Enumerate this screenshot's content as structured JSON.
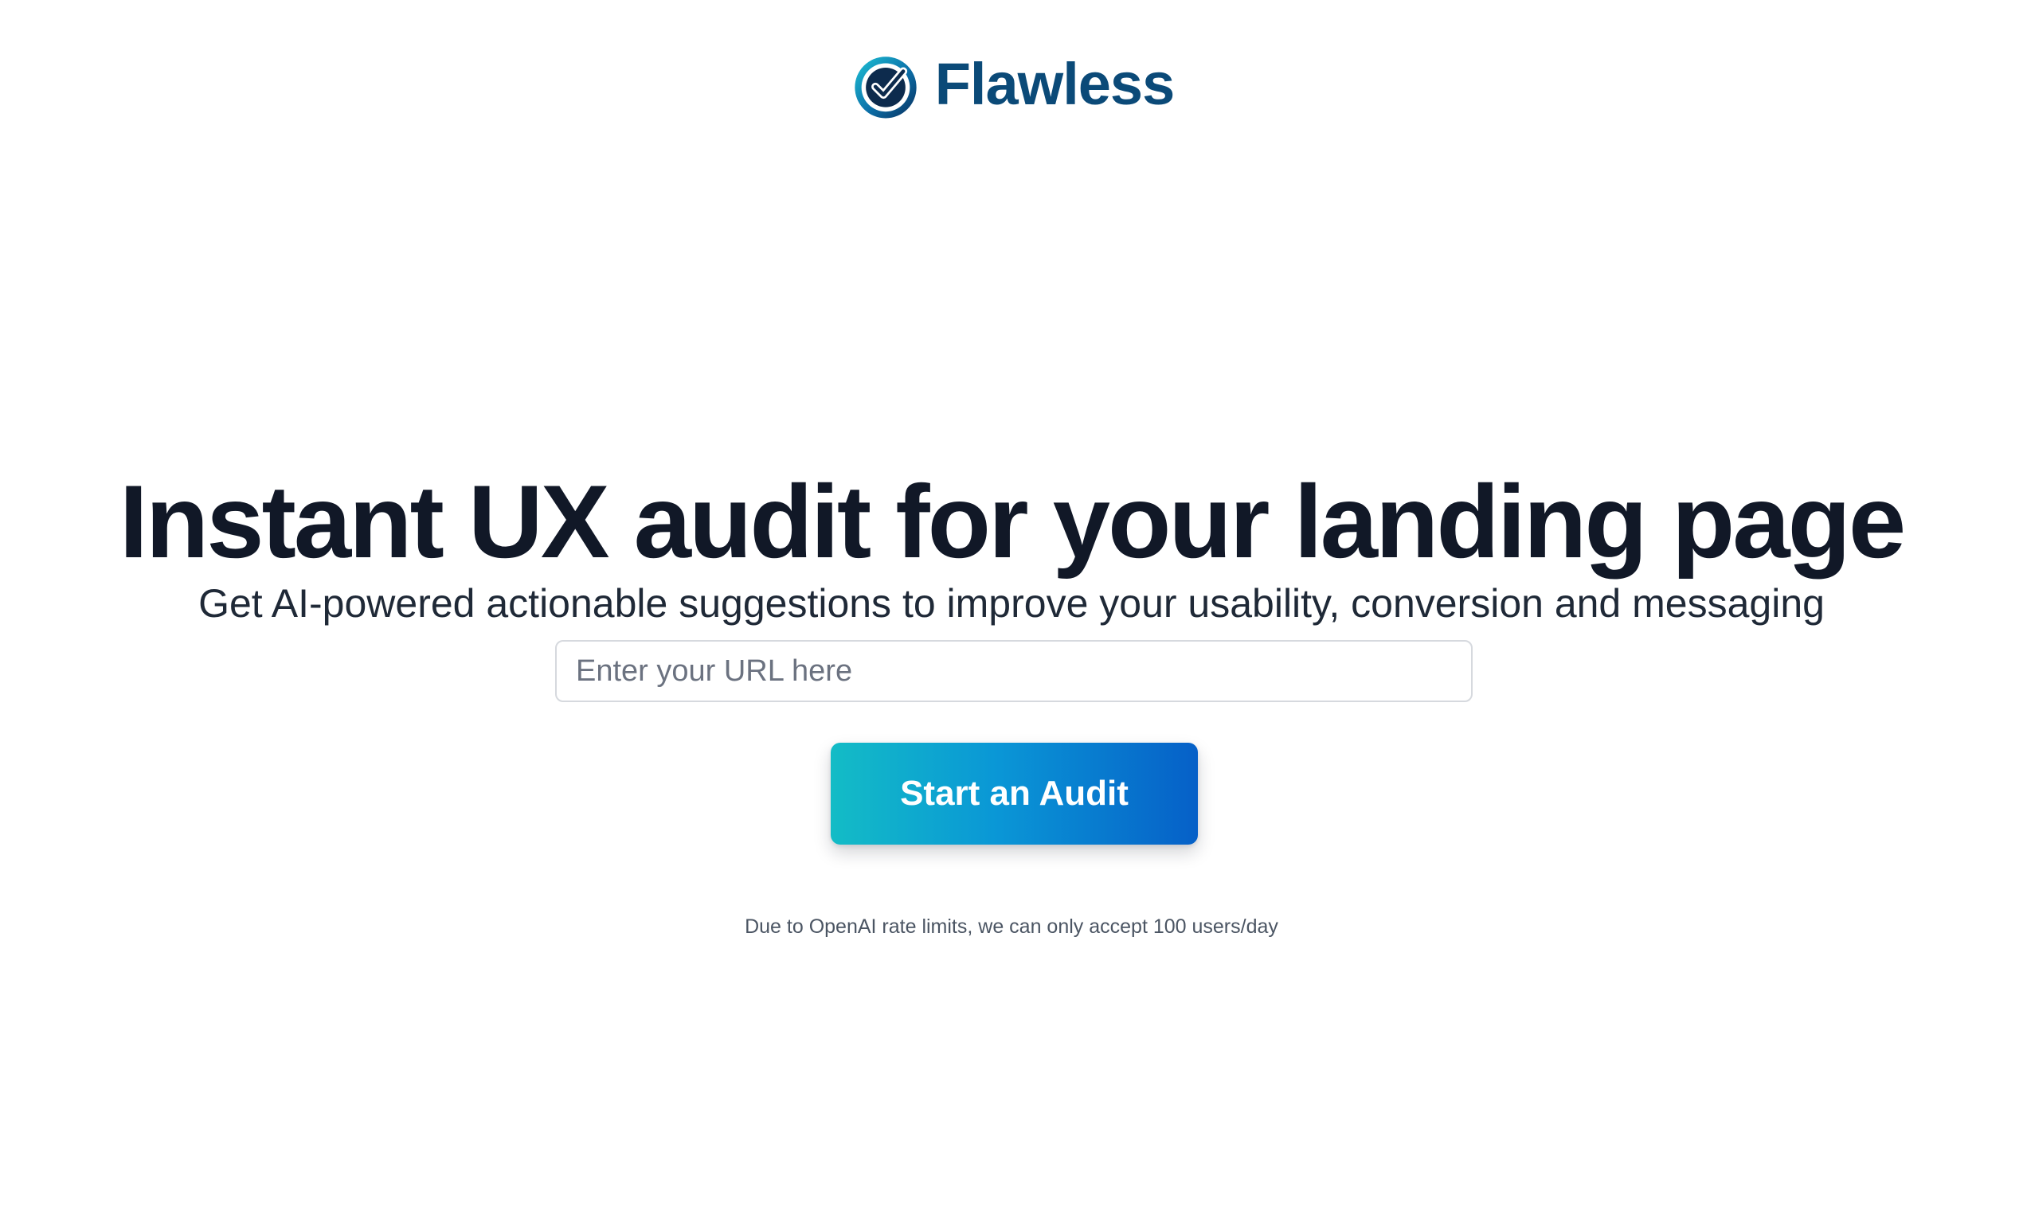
{
  "brand": {
    "name": "Flawless",
    "logo_icon": "check-circle-icon",
    "color": "#0b4a78"
  },
  "hero": {
    "title": "Instant UX audit for your landing page",
    "subtitle": "Get AI-powered actionable suggestions to improve your usability, conversion and messaging"
  },
  "form": {
    "url_placeholder": "Enter your URL here",
    "url_value": "",
    "submit_label": "Start an Audit",
    "button_gradient": [
      "#13bcc6",
      "#0660c8"
    ]
  },
  "notice": "Due to OpenAI rate limits, we can only accept 100 users/day"
}
